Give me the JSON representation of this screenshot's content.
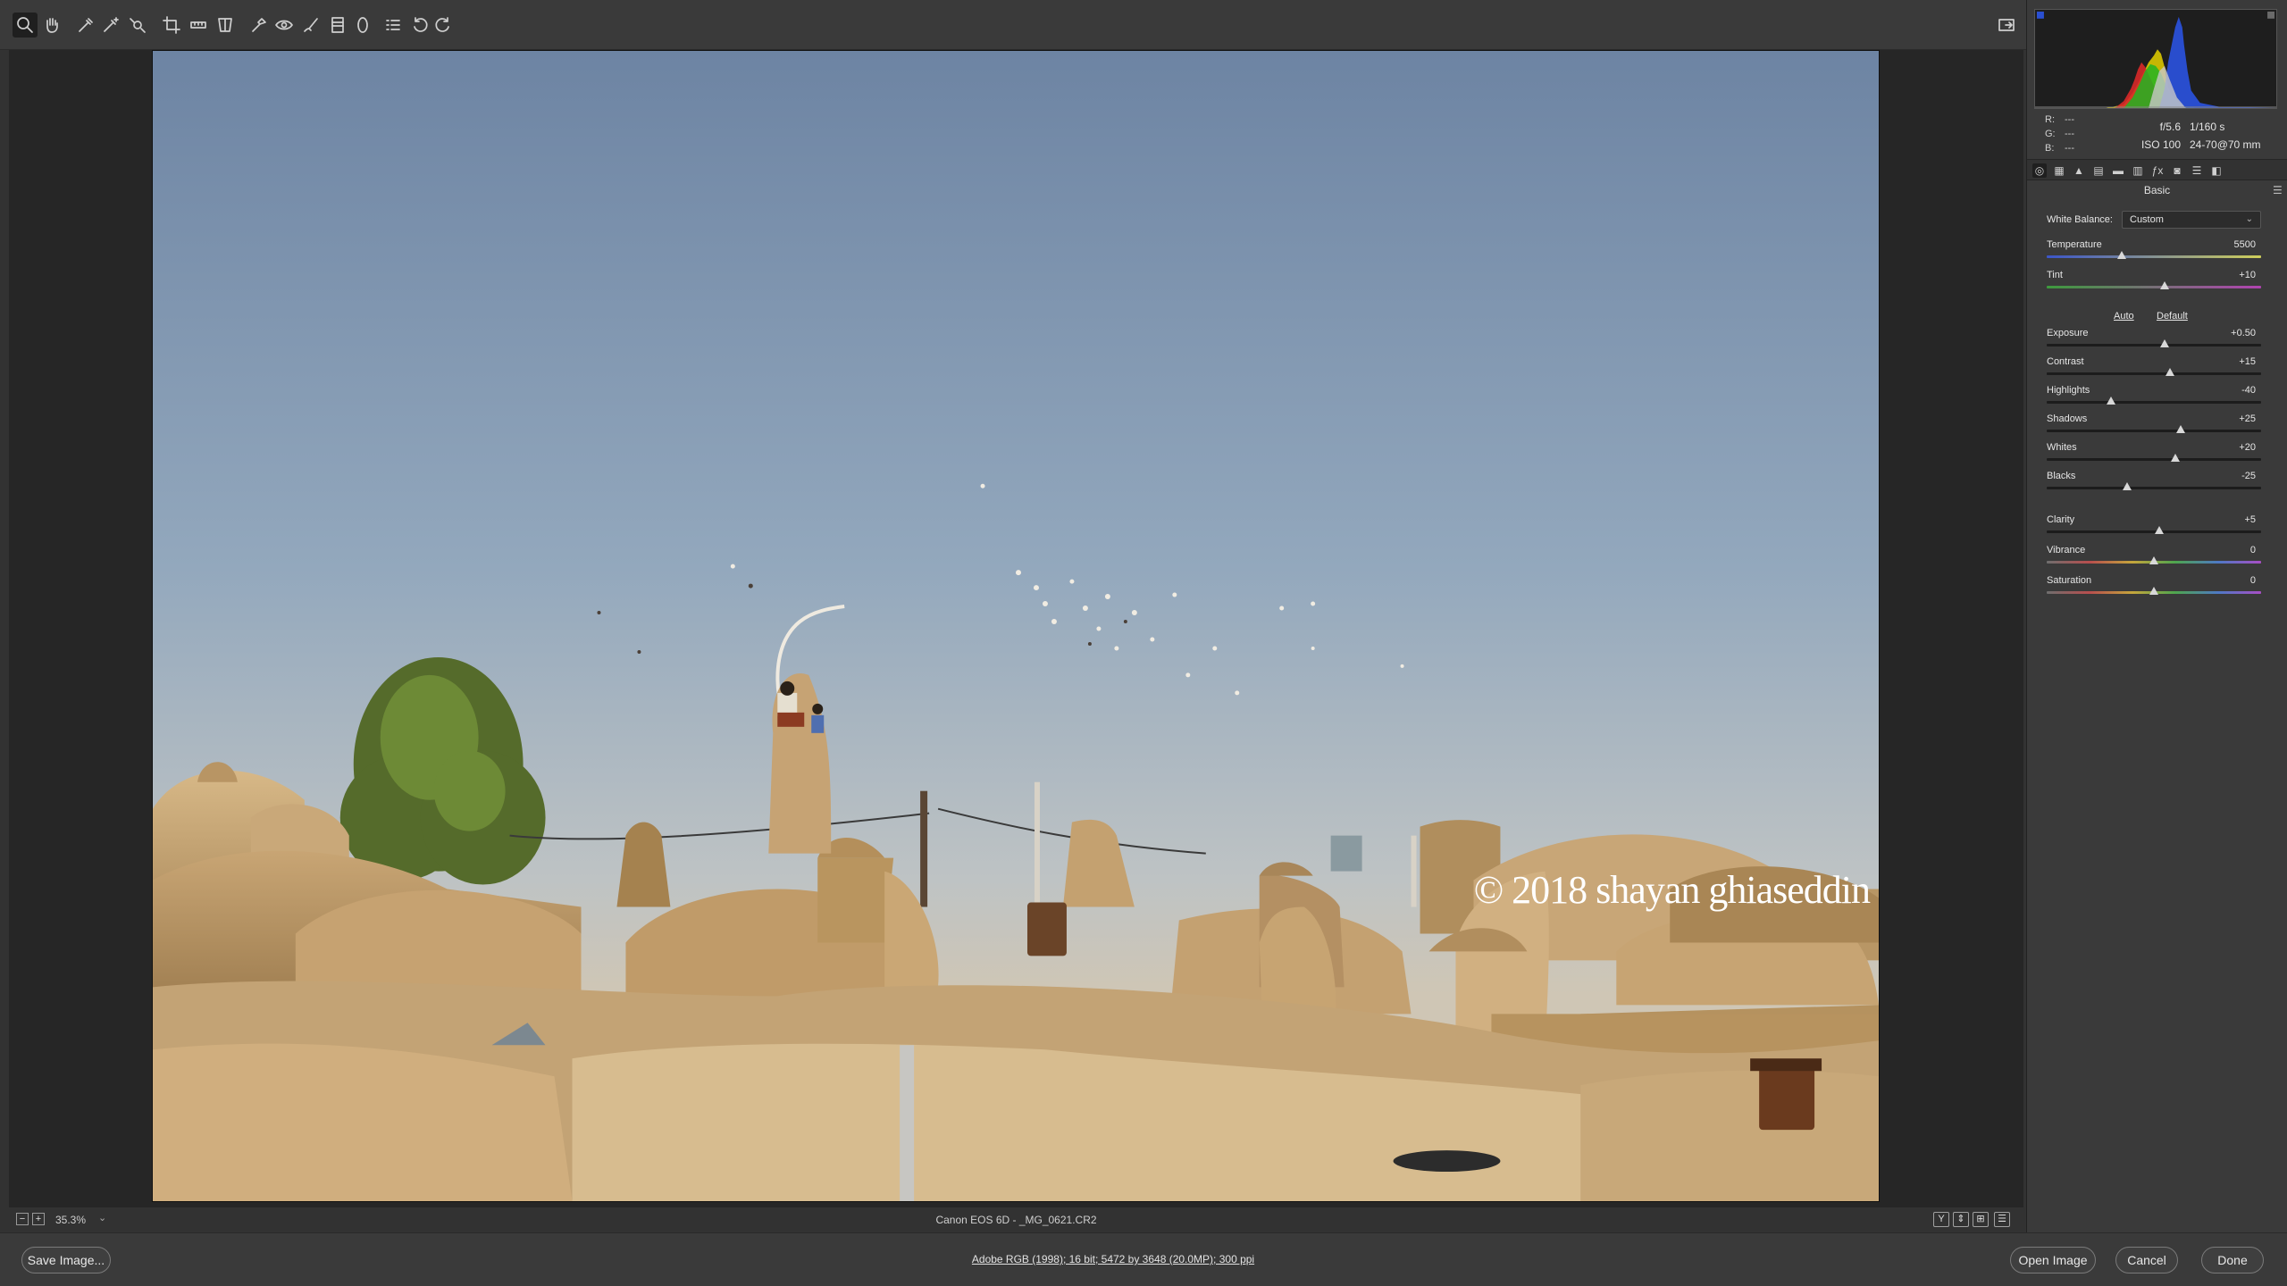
{
  "toolbar": {
    "tools": [
      {
        "icon": "zoom-icon",
        "active": true
      },
      {
        "icon": "hand-icon",
        "active": false
      },
      {
        "icon": "white-balance-icon",
        "active": false
      },
      {
        "icon": "color-sampler-icon",
        "active": false
      },
      {
        "icon": "targeted-adjustment-icon",
        "active": false
      },
      {
        "icon": "crop-icon",
        "active": false
      },
      {
        "icon": "straighten-icon",
        "active": false
      },
      {
        "icon": "transform-icon",
        "active": false
      },
      {
        "icon": "spot-removal-icon",
        "active": false
      },
      {
        "icon": "red-eye-icon",
        "active": false
      },
      {
        "icon": "adjustment-brush-icon",
        "active": false
      },
      {
        "icon": "graduated-filter-icon",
        "active": false
      },
      {
        "icon": "radial-filter-icon",
        "active": false
      },
      {
        "icon": "preferences-icon",
        "active": false
      },
      {
        "icon": "rotate-left-icon",
        "active": false
      },
      {
        "icon": "rotate-right-icon",
        "active": false
      }
    ],
    "fullscreen_icon": "fullscreen-icon"
  },
  "canvas": {
    "watermark": "© 2018 shayan ghiaseddin"
  },
  "status": {
    "zoom_minus": "−",
    "zoom_plus": "+",
    "zoom_value": "35.3%",
    "zoom_arrow": "⌄",
    "file_info": "Canon EOS 6D  -  _MG_0621.CR2",
    "view_buttons": [
      "Y",
      "⇕",
      "⊞",
      "☰"
    ]
  },
  "bottom": {
    "save_label": "Save Image...",
    "workflow_info": "Adobe RGB (1998); 16 bit; 5472 by 3648 (20.0MP); 300 ppi",
    "open_label": "Open Image",
    "cancel_label": "Cancel",
    "done_label": "Done"
  },
  "info": {
    "r_label": "R:",
    "r_value": "---",
    "g_label": "G:",
    "g_value": "---",
    "b_label": "B:",
    "b_value": "---",
    "aperture": "f/5.6",
    "shutter": "1/160 s",
    "iso": "ISO 100",
    "lens": "24-70@70 mm"
  },
  "panel": {
    "title": "Basic",
    "menu_icon": "☰",
    "tabs": [
      "◎",
      "▦",
      "▲",
      "▤",
      "▬",
      "▥",
      "ƒx",
      "◙",
      "☰",
      "◧"
    ],
    "white_balance_label": "White Balance:",
    "white_balance_value": "Custom",
    "auto_label": "Auto",
    "default_label": "Default",
    "sliders": [
      {
        "id": "temperature",
        "label": "Temperature",
        "value": "5500",
        "min": 2000,
        "max": 50000,
        "pos": 0.35
      },
      {
        "id": "tint",
        "label": "Tint",
        "value": "+10",
        "min": -150,
        "max": 150,
        "pos": 0.55
      },
      {
        "id": "exposure",
        "label": "Exposure",
        "value": "+0.50",
        "min": -5,
        "max": 5,
        "pos": 0.55
      },
      {
        "id": "contrast",
        "label": "Contrast",
        "value": "+15",
        "min": -100,
        "max": 100,
        "pos": 0.575
      },
      {
        "id": "highlights",
        "label": "Highlights",
        "value": "-40",
        "min": -100,
        "max": 100,
        "pos": 0.3
      },
      {
        "id": "shadows",
        "label": "Shadows",
        "value": "+25",
        "min": -100,
        "max": 100,
        "pos": 0.625
      },
      {
        "id": "whites",
        "label": "Whites",
        "value": "+20",
        "min": -100,
        "max": 100,
        "pos": 0.6
      },
      {
        "id": "blacks",
        "label": "Blacks",
        "value": "-25",
        "min": -100,
        "max": 100,
        "pos": 0.375
      },
      {
        "id": "clarity",
        "label": "Clarity",
        "value": "+5",
        "min": -100,
        "max": 100,
        "pos": 0.525
      },
      {
        "id": "vibrance",
        "label": "Vibrance",
        "value": "0",
        "min": -100,
        "max": 100,
        "pos": 0.5
      },
      {
        "id": "saturation",
        "label": "Saturation",
        "value": "0",
        "min": -100,
        "max": 100,
        "pos": 0.5
      }
    ]
  }
}
